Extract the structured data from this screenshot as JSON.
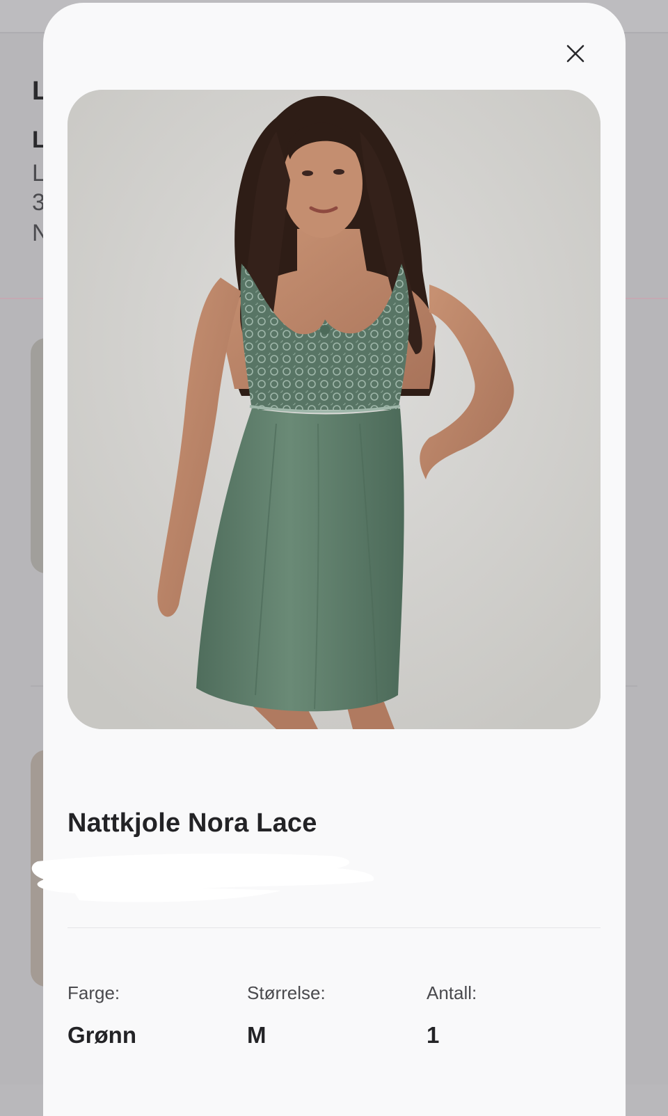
{
  "product": {
    "title": "Nattkjole Nora Lace",
    "image_description": "product-photo"
  },
  "attributes": [
    {
      "label": "Farge:",
      "value": "Grønn"
    },
    {
      "label": "Størrelse:",
      "value": "M"
    },
    {
      "label": "Antall:",
      "value": "1"
    }
  ],
  "icons": {
    "close": "close-icon"
  },
  "background_page": {
    "letters": [
      "L",
      "L",
      "L",
      "3",
      "N"
    ]
  },
  "colors": {
    "modal_bg": "#f9f9fa",
    "overlay_bg": "#b7b6b9",
    "text_primary": "#232326",
    "text_secondary": "#4a4a4e",
    "dress_green": "#5e7d6a"
  }
}
